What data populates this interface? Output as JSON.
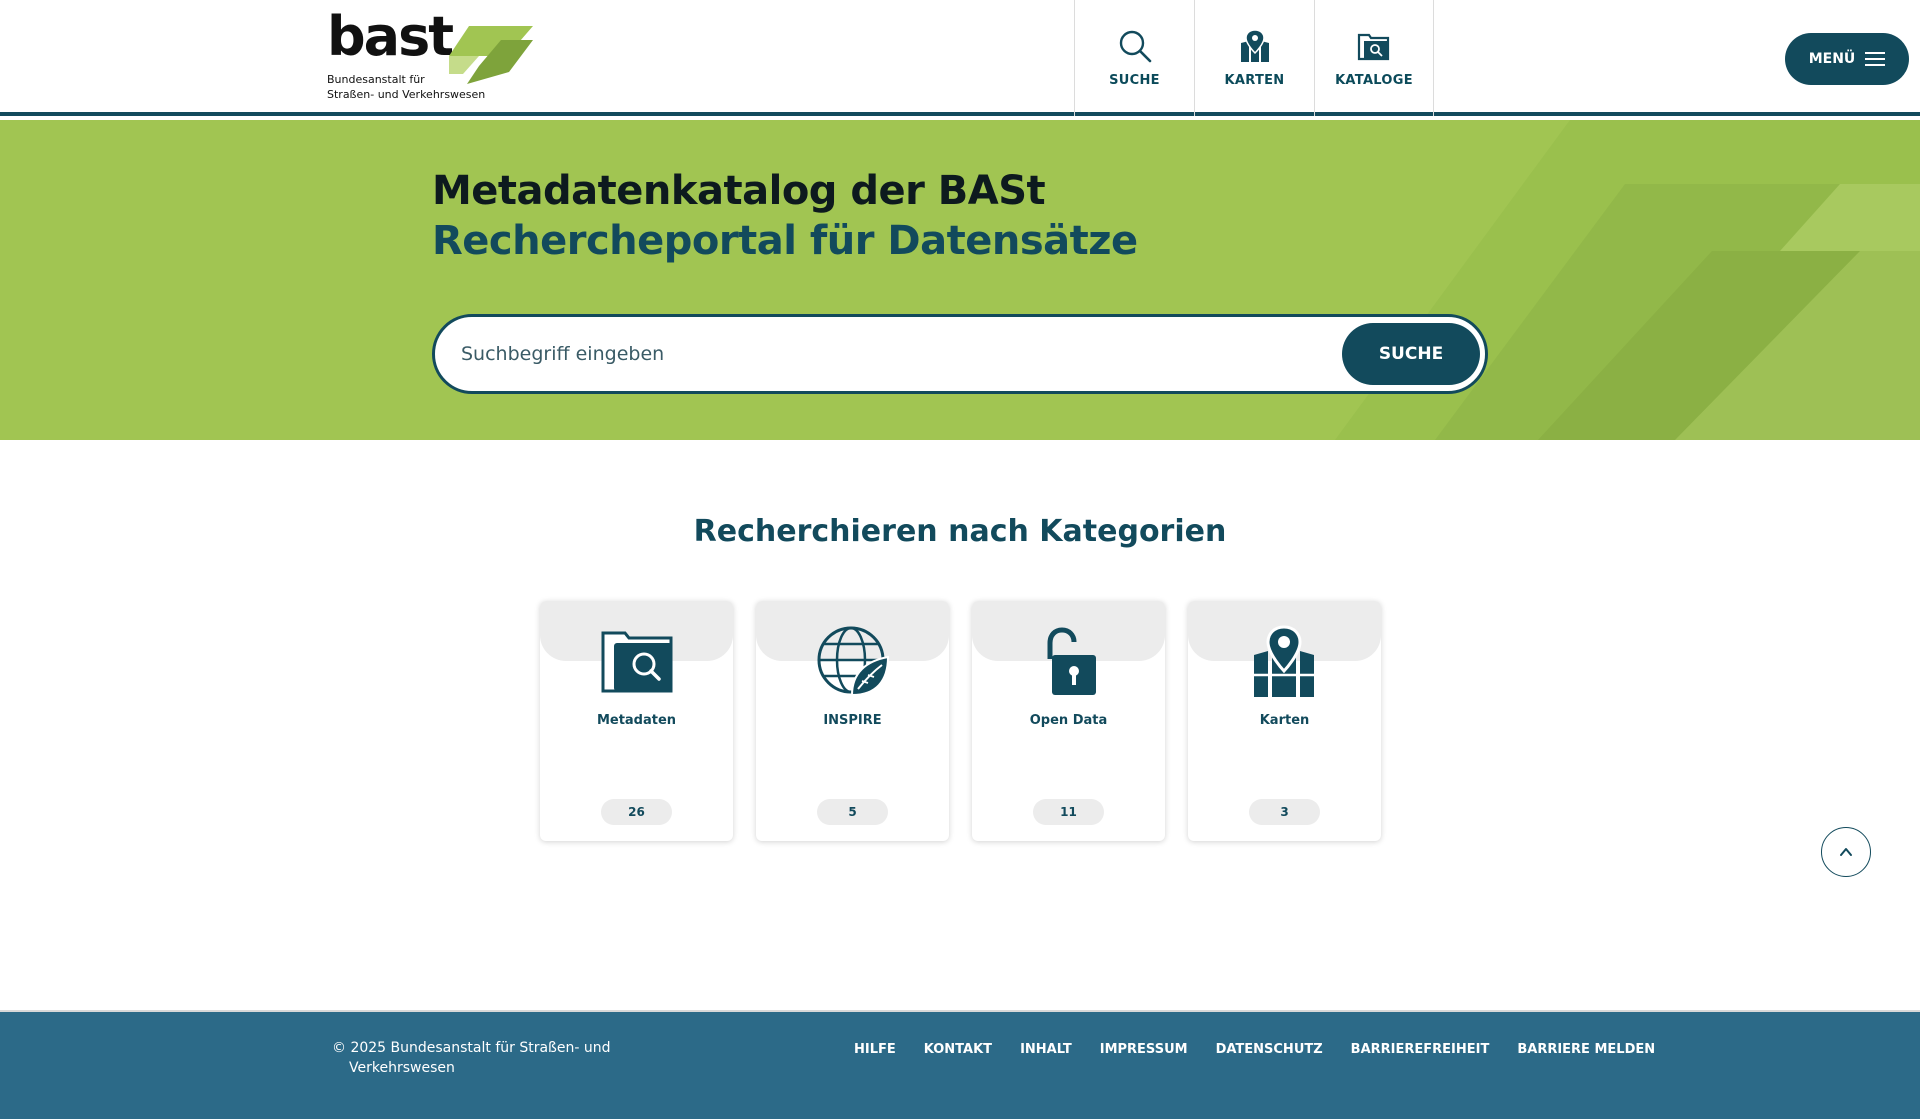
{
  "brand": {
    "wordmark": "bast",
    "subtitle_line1": "Bundesanstalt für",
    "subtitle_line2": "Straßen- und Verkehrswesen",
    "colors": {
      "primary": "#124a5c",
      "accent": "#a1c552",
      "footer": "#2c6a88"
    }
  },
  "topnav": {
    "items": [
      {
        "label": "SUCHE",
        "icon": "search-icon"
      },
      {
        "label": "KARTEN",
        "icon": "map-pin-icon"
      },
      {
        "label": "KATALOGE",
        "icon": "folder-search-icon"
      }
    ]
  },
  "menu": {
    "label": "MENÜ",
    "icon": "hamburger-icon"
  },
  "hero": {
    "title": "Metadatenkatalog der BASt",
    "subtitle": "Rechercheportal für Datensätze",
    "search_placeholder": "Suchbegriff eingeben",
    "search_button": "SUCHE"
  },
  "categories": {
    "title": "Recherchieren nach Kategorien",
    "items": [
      {
        "label": "Metadaten",
        "count": "26",
        "icon": "folder-search-icon"
      },
      {
        "label": "INSPIRE",
        "count": "5",
        "icon": "globe-leaf-icon"
      },
      {
        "label": "Open Data",
        "count": "11",
        "icon": "open-lock-icon"
      },
      {
        "label": "Karten",
        "count": "3",
        "icon": "map-pin-icon"
      }
    ]
  },
  "back_to_top": {
    "icon": "chevron-up-icon"
  },
  "footer": {
    "copyright": "© 2025 Bundesanstalt für Straßen- und Verkehrswesen",
    "links": [
      "HILFE",
      "KONTAKT",
      "INHALT",
      "IMPRESSUM",
      "DATENSCHUTZ",
      "BARRIEREFREIHEIT",
      "BARRIERE MELDEN"
    ]
  }
}
